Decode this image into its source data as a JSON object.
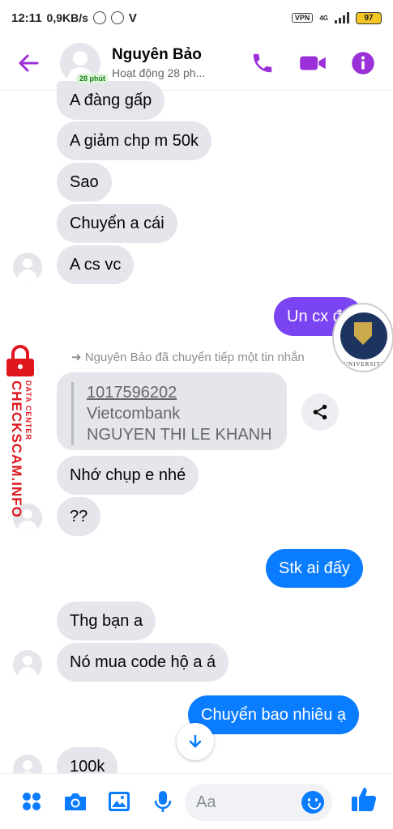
{
  "status_bar": {
    "time": "12:11",
    "speed": "0,9KB/s",
    "vpn": "VPN",
    "network": "4G",
    "battery": "97"
  },
  "header": {
    "name": "Nguyên Bảo",
    "badge": "28 phút",
    "status": "Hoạt động 28 ph..."
  },
  "messages": [
    {
      "text": "A đàng gấp",
      "side": "in"
    },
    {
      "text": "A giảm chp m 50k",
      "side": "in"
    },
    {
      "text": "Sao",
      "side": "in"
    },
    {
      "text": "Chuyển a cái",
      "side": "in"
    },
    {
      "text": "A cs vc",
      "side": "in"
    },
    {
      "text": "Un cx đc",
      "side": "out"
    },
    {
      "text": "Nhớ chụp e nhé",
      "side": "in"
    },
    {
      "text": "??",
      "side": "in"
    },
    {
      "text": "Stk ai đấy",
      "side": "out"
    },
    {
      "text": "Thg bạn a",
      "side": "in"
    },
    {
      "text": "Nó mua code hộ a á",
      "side": "in"
    },
    {
      "text": "Chuyển bao nhiêu ạ",
      "side": "out"
    },
    {
      "text": "100k",
      "side": "in"
    }
  ],
  "forward": {
    "note": "Nguyên Bảo đã chuyển tiếp một tin nhắn",
    "account": "1017596202",
    "bank": "Vietcombank",
    "holder": "NGUYEN THI LE KHANH"
  },
  "watermark": {
    "main": "CHECKSCAM.INFO",
    "sub": "DATA CENTER",
    "seal_text": "UNIVERSITY"
  },
  "composer": {
    "placeholder": "Aa"
  },
  "colors": {
    "accent_purple": "#9b30d9",
    "bubble_blue": "#0a7cff",
    "bubble_purple": "#7b44f2",
    "bubble_gray": "#e4e6eb"
  }
}
